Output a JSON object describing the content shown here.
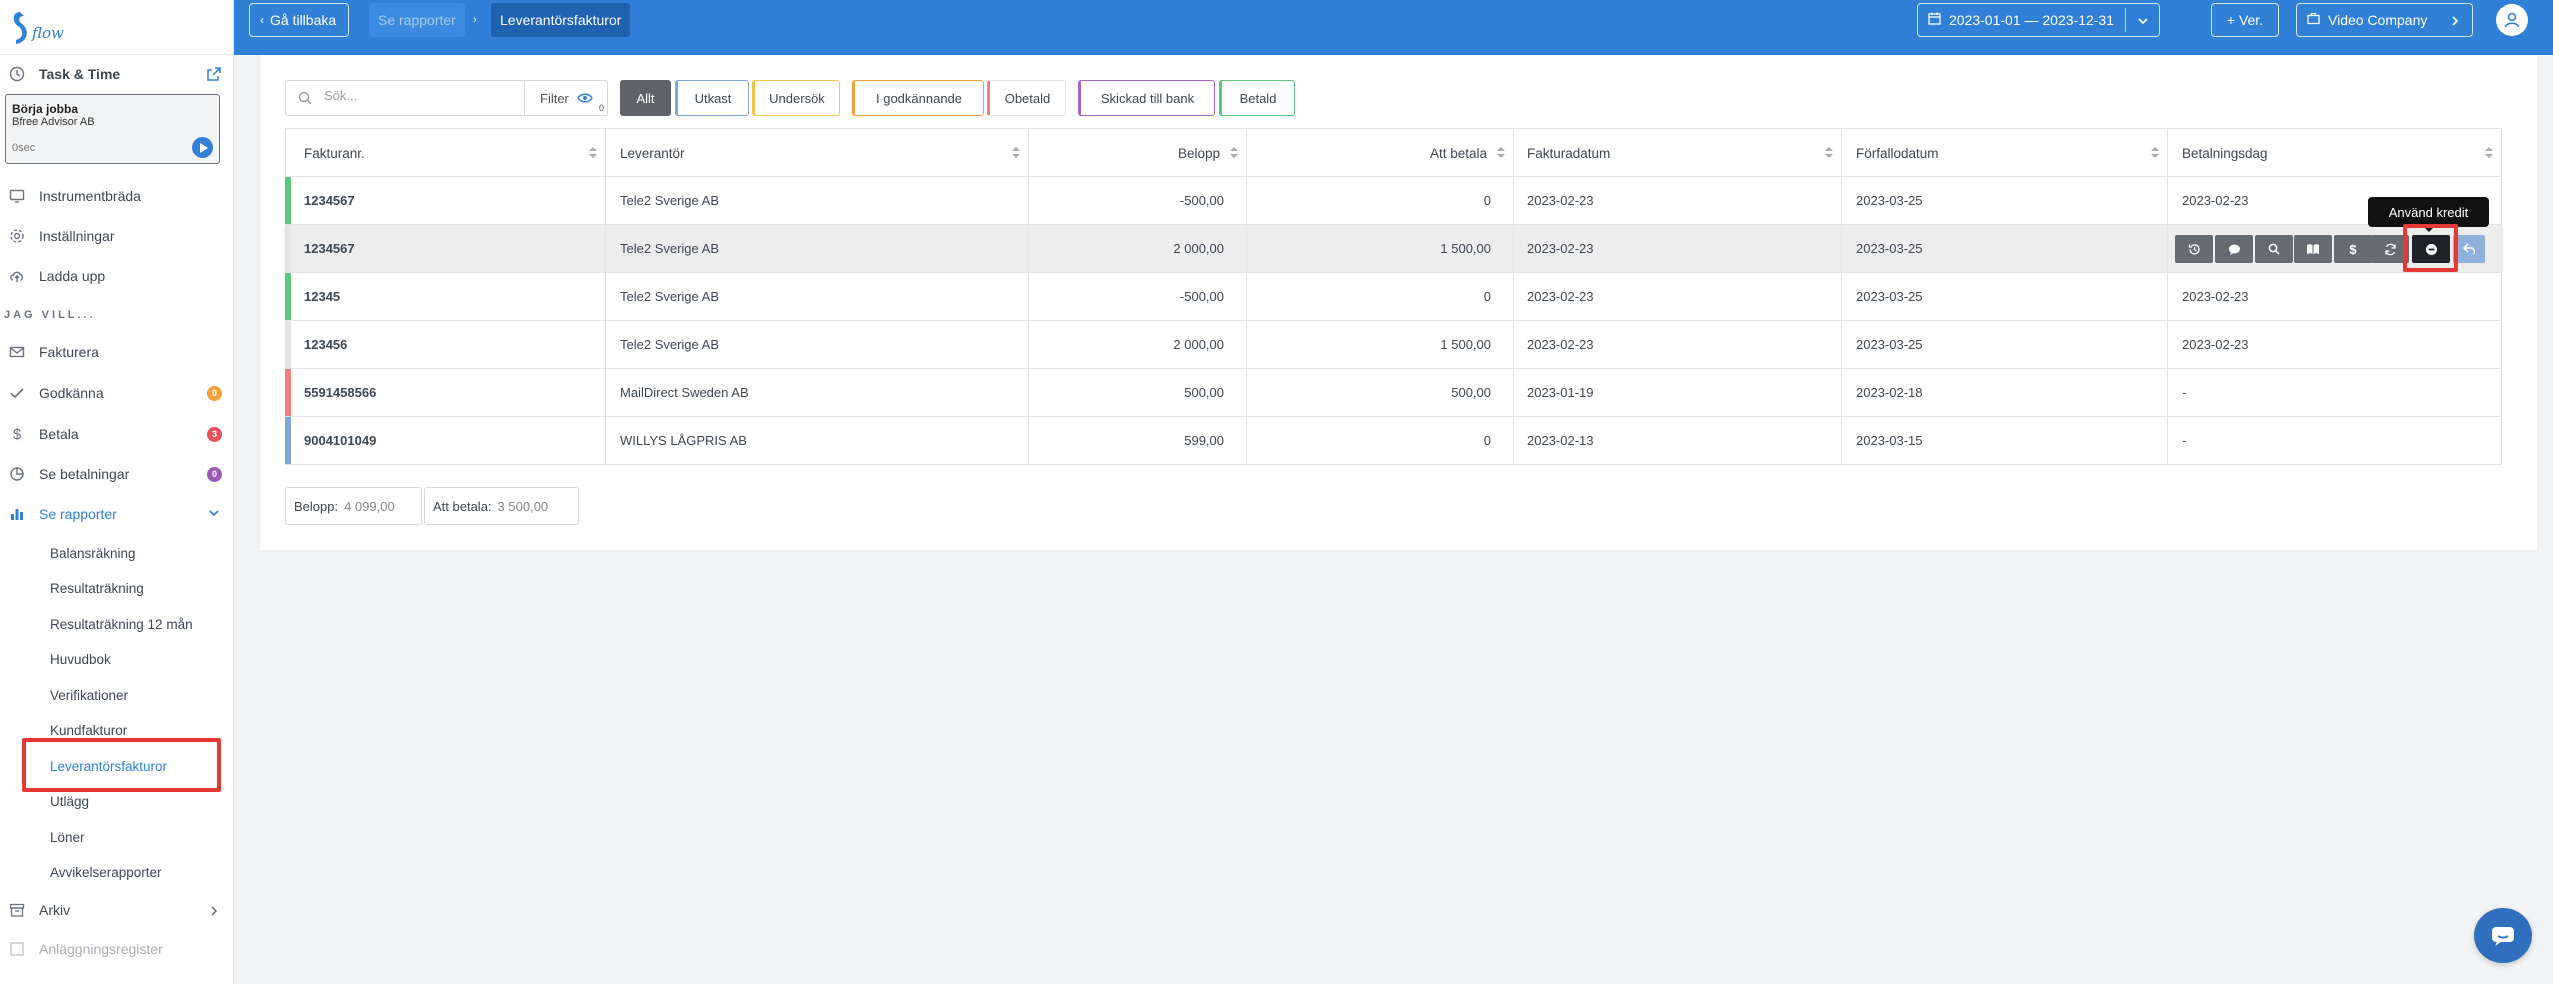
{
  "sidebar": {
    "task_time": "Task & Time",
    "timer": {
      "title": "Börja jobba",
      "company": "Bfree Advisor AB",
      "elapsed": "0sec"
    },
    "nav": [
      {
        "label": "Instrumentbräda"
      },
      {
        "label": "Inställningar"
      },
      {
        "label": "Ladda upp"
      }
    ],
    "section_label": "JAG VILL...",
    "actions": [
      {
        "label": "Fakturera"
      },
      {
        "label": "Godkänna",
        "badge": "0"
      },
      {
        "label": "Betala",
        "badge": "3"
      },
      {
        "label": "Se betalningar",
        "badge": "0"
      },
      {
        "label": "Se rapporter"
      }
    ],
    "reports": [
      "Balansräkning",
      "Resultaträkning",
      "Resultaträkning 12 mån",
      "Huvudbok",
      "Verifikationer",
      "Kundfakturor",
      "Leverantörsfakturor",
      "Utlägg",
      "Löner",
      "Avvikelserapporter"
    ],
    "archive": "Arkiv",
    "asset_register": "Anläggningsregister",
    "colors": {
      "accent": "#2f80d6",
      "badge_orange": "#f0a33a",
      "badge_red": "#e8505b",
      "badge_purple": "#9b59b6"
    }
  },
  "topbar": {
    "back": "Gå tillbaka",
    "crumb_parent": "Se rapporter",
    "crumb_current": "Leverantörsfakturor",
    "date_range": "2023-01-01 — 2023-12-31",
    "new_ver": "+ Ver.",
    "company": "Video Company"
  },
  "filters": {
    "search_placeholder": "Sök...",
    "filter_label": "Filter",
    "filter_count": "0",
    "chips": [
      {
        "label": "Allt",
        "color": "#5f6368"
      },
      {
        "label": "Utkast",
        "color": "#7fa7d9"
      },
      {
        "label": "Undersök",
        "color": "#f2c744"
      },
      {
        "label": "I godkännande",
        "color": "#f0a33a"
      },
      {
        "label": "Obetald",
        "color": "#f08080"
      },
      {
        "label": "Skickad till bank",
        "color": "#a566c8"
      },
      {
        "label": "Betald",
        "color": "#5cc67a"
      }
    ]
  },
  "table": {
    "headers": [
      "Fakturanr.",
      "Leverantör",
      "Belopp",
      "Att betala",
      "Fakturadatum",
      "Förfallodatum",
      "Betalningsdag"
    ],
    "rows": [
      {
        "nr": "1234567",
        "supplier": "Tele2 Sverige AB",
        "amount": "-500,00",
        "to_pay": "0",
        "inv_date": "2023-02-23",
        "due_date": "2023-03-25",
        "pay_date": "2023-02-23",
        "status_color": "#5cc67a"
      },
      {
        "nr": "1234567",
        "supplier": "Tele2 Sverige AB",
        "amount": "2 000,00",
        "to_pay": "1 500,00",
        "inv_date": "2023-02-23",
        "due_date": "2023-03-25",
        "pay_date": "",
        "status_color": "#e3e5e8"
      },
      {
        "nr": "12345",
        "supplier": "Tele2 Sverige AB",
        "amount": "-500,00",
        "to_pay": "0",
        "inv_date": "2023-02-23",
        "due_date": "2023-03-25",
        "pay_date": "2023-02-23",
        "status_color": "#5cc67a"
      },
      {
        "nr": "123456",
        "supplier": "Tele2 Sverige AB",
        "amount": "2 000,00",
        "to_pay": "1 500,00",
        "inv_date": "2023-02-23",
        "due_date": "2023-03-25",
        "pay_date": "2023-02-23",
        "status_color": "#e3e5e8"
      },
      {
        "nr": "5591458566",
        "supplier": "MailDirect Sweden AB",
        "amount": "500,00",
        "to_pay": "500,00",
        "inv_date": "2023-01-19",
        "due_date": "2023-02-18",
        "pay_date": "-",
        "status_color": "#f08080"
      },
      {
        "nr": "9004101049",
        "supplier": "WILLYS LÅGPRIS AB",
        "amount": "599,00",
        "to_pay": "0",
        "inv_date": "2023-02-13",
        "due_date": "2023-03-15",
        "pay_date": "-",
        "status_color": "#7fa7d9"
      }
    ],
    "row_actions": [
      "history-icon",
      "comment-icon",
      "search-icon",
      "book-icon",
      "dollar-icon",
      "refresh-icon",
      "minus-circle-icon",
      "undo-icon"
    ],
    "tooltip": "Använd kredit"
  },
  "summary": {
    "amount_label": "Belopp:",
    "amount_value": "4 099,00",
    "to_pay_label": "Att betala:",
    "to_pay_value": "3 500,00"
  }
}
